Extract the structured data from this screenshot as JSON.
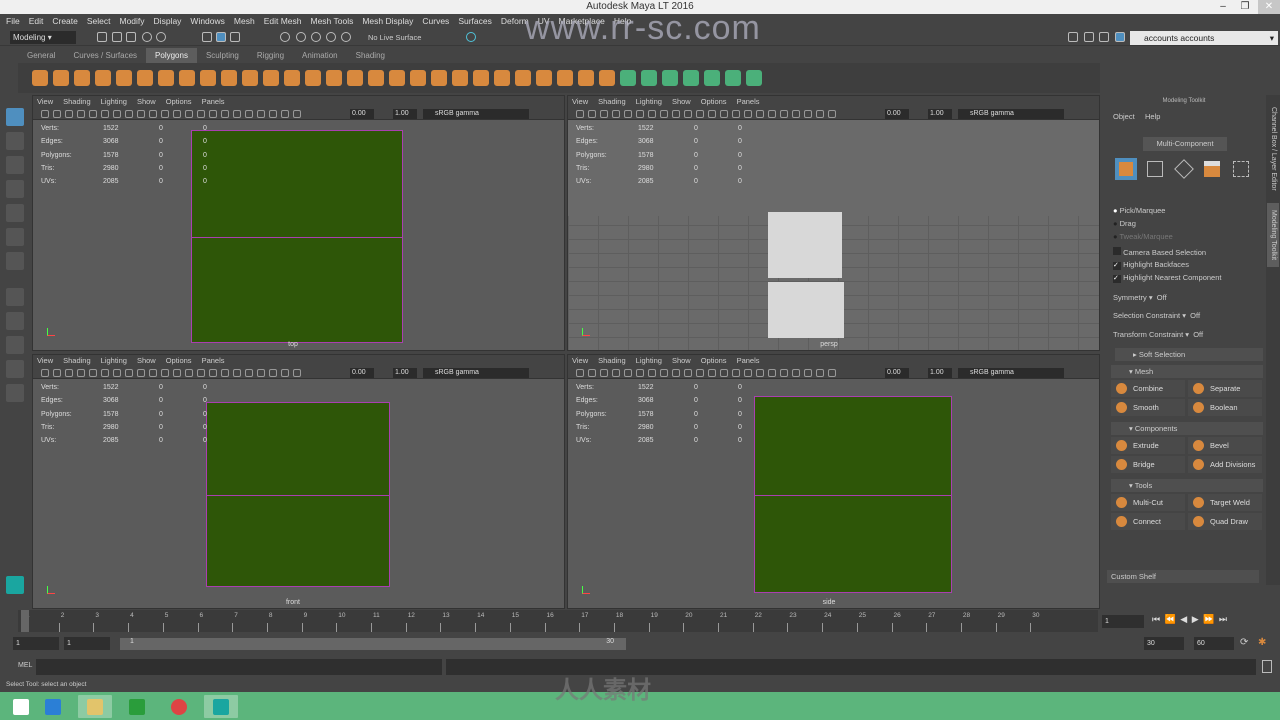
{
  "window": {
    "title": "Autodesk Maya LT 2016",
    "watermark": "www.rr-sc.com",
    "watermark2": "人人素材"
  },
  "menu": [
    "File",
    "Edit",
    "Create",
    "Select",
    "Modify",
    "Display",
    "Windows",
    "Mesh",
    "Edit Mesh",
    "Mesh Tools",
    "Mesh Display",
    "Curves",
    "Surfaces",
    "Deform",
    "UV",
    "Marketplace",
    "Help"
  ],
  "status": {
    "mode": "Modeling",
    "live_surface": "No Live Surface",
    "account": "accounts accounts"
  },
  "shelf_tabs": [
    {
      "label": "General"
    },
    {
      "label": "Curves / Surfaces"
    },
    {
      "label": "Polygons",
      "active": true
    },
    {
      "label": "Sculpting"
    },
    {
      "label": "Rigging"
    },
    {
      "label": "Animation"
    },
    {
      "label": "Shading"
    }
  ],
  "viewport_menu": [
    "View",
    "Shading",
    "Lighting",
    "Show",
    "Options",
    "Panels"
  ],
  "viewport_toolbar": {
    "exposure": "0.00",
    "gamma": "1.00",
    "colorspace": "sRGB gamma"
  },
  "hud": [
    {
      "label": "Verts:",
      "v": "1522",
      "a": "0",
      "b": "0"
    },
    {
      "label": "Edges:",
      "v": "3068",
      "a": "0",
      "b": "0"
    },
    {
      "label": "Polygons:",
      "v": "1578",
      "a": "0",
      "b": "0"
    },
    {
      "label": "Tris:",
      "v": "2980",
      "a": "0",
      "b": "0"
    },
    {
      "label": "UVs:",
      "v": "2085",
      "a": "0",
      "b": "0"
    }
  ],
  "viewports": [
    {
      "camera": "top"
    },
    {
      "camera": "persp"
    },
    {
      "camera": "front"
    },
    {
      "camera": "side"
    }
  ],
  "toolkit": {
    "title": "Modeling Toolkit",
    "menu": [
      "Object",
      "Help"
    ],
    "mode": "Multi-Component",
    "pick": [
      "Pick/Marquee",
      "Drag",
      "Tweak/Marquee"
    ],
    "checks": [
      {
        "label": "Camera Based Selection",
        "checked": false
      },
      {
        "label": "Highlight Backfaces",
        "checked": true
      },
      {
        "label": "Highlight Nearest Component",
        "checked": true
      }
    ],
    "symmetry": {
      "label": "Symmetry",
      "value": "Off"
    },
    "sel_constraint": {
      "label": "Selection Constraint",
      "value": "Off"
    },
    "xform_constraint": {
      "label": "Transform Constraint",
      "value": "Off"
    },
    "soft_selection": "Soft Selection",
    "sections": [
      {
        "title": "Mesh",
        "buttons": [
          "Combine",
          "Separate",
          "Smooth",
          "Boolean"
        ]
      },
      {
        "title": "Components",
        "buttons": [
          "Extrude",
          "Bevel",
          "Bridge",
          "Add Divisions"
        ]
      },
      {
        "title": "Tools",
        "buttons": [
          "Multi-Cut",
          "Target Weld",
          "Connect",
          "Quad Draw"
        ]
      }
    ],
    "custom_shelf": "Custom Shelf"
  },
  "side_tabs": [
    "Channel Box / Layer Editor",
    "Modeling Toolkit"
  ],
  "timeline": {
    "ticks": [
      "1",
      "2",
      "3",
      "4",
      "5",
      "6",
      "7",
      "8",
      "9",
      "10",
      "11",
      "12",
      "13",
      "14",
      "15",
      "16",
      "17",
      "18",
      "19",
      "20",
      "21",
      "22",
      "23",
      "24",
      "25",
      "26",
      "27",
      "28",
      "29",
      "30"
    ],
    "current": "1"
  },
  "range": {
    "start": "1",
    "playback_start": "1",
    "slider_start": "1",
    "slider_end": "30",
    "playback_end": "30",
    "end": "60"
  },
  "cmd": {
    "label": "MEL"
  },
  "help": "Select Tool: select an object",
  "taskbar": [
    "start",
    "internet-explorer",
    "file-explorer",
    "store",
    "chrome",
    "maya"
  ]
}
